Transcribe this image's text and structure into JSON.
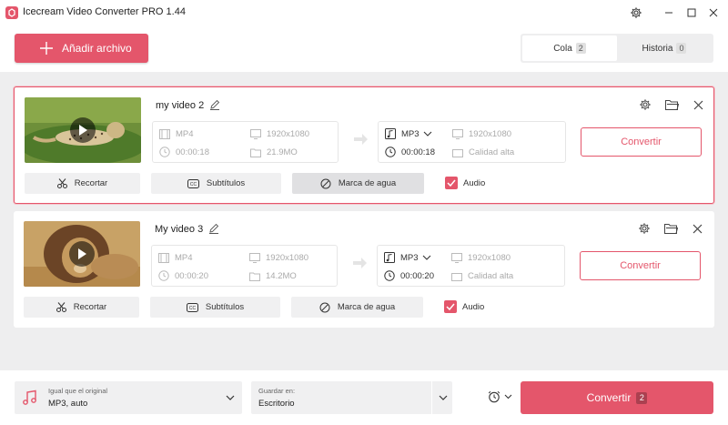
{
  "app": {
    "title": "Icecream Video Converter PRO 1.44"
  },
  "header": {
    "add_file_label": "Añadir archivo",
    "tabs": [
      {
        "label": "Cola",
        "count": "2"
      },
      {
        "label": "Historia",
        "count": "0"
      }
    ]
  },
  "items": [
    {
      "title": "my video 2",
      "source": {
        "format": "MP4",
        "resolution": "1920x1080",
        "duration": "00:00:18",
        "size": "21.9MO"
      },
      "target": {
        "format": "MP3",
        "resolution": "1920x1080",
        "duration": "00:00:18",
        "quality": "Calidad alta"
      },
      "convert_label": "Convertir",
      "tools": {
        "trim": "Recortar",
        "subtitles": "Subtítulos",
        "watermark": "Marca de agua",
        "audio": "Audio"
      }
    },
    {
      "title": "My video 3",
      "source": {
        "format": "MP4",
        "resolution": "1920x1080",
        "duration": "00:00:20",
        "size": "14.2MO"
      },
      "target": {
        "format": "MP3",
        "resolution": "1920x1080",
        "duration": "00:00:20",
        "quality": "Calidad alta"
      },
      "convert_label": "Convertir",
      "tools": {
        "trim": "Recortar",
        "subtitles": "Subtítulos",
        "watermark": "Marca de agua",
        "audio": "Audio"
      }
    }
  ],
  "bottom": {
    "preset_label": "Igual que el original",
    "preset_value": "MP3, auto",
    "save_label": "Guardar en:",
    "save_value": "Escritorio",
    "convert_label": "Convertir",
    "convert_count": "2"
  },
  "colors": {
    "accent": "#e4566b",
    "background": "#eeeeef"
  }
}
